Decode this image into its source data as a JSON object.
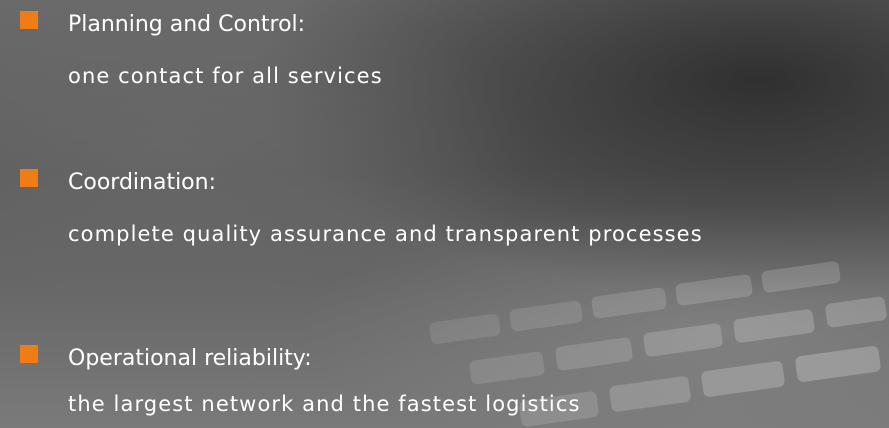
{
  "items": [
    {
      "title": "Planning and Control:",
      "description": "one contact for all services"
    },
    {
      "title": "Coordination:",
      "description": "complete quality assurance and transparent processes"
    },
    {
      "title": "Operational reliability:",
      "description": "the largest network and the fastest logistics"
    }
  ],
  "colors": {
    "accent": "#f07c18",
    "text": "#ffffff",
    "background": "#5e5e5e"
  },
  "icons": {
    "bullet": "orange-square-bullet-icon"
  }
}
